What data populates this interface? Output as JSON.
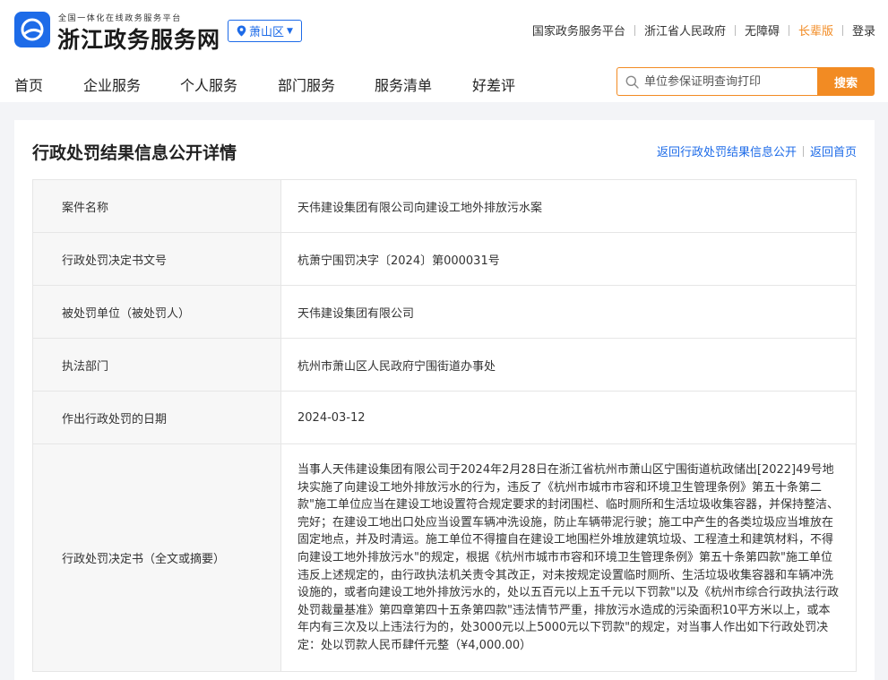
{
  "header": {
    "slogan": "全国一体化在线政务服务平台",
    "site_title": "浙江政务服务网",
    "region": "萧山区",
    "top_links": [
      "国家政务服务平台",
      "浙江省人民政府",
      "无障碍",
      "长辈版",
      "登录"
    ]
  },
  "nav": {
    "items": [
      "首页",
      "企业服务",
      "个人服务",
      "部门服务",
      "服务清单",
      "好差评"
    ]
  },
  "search": {
    "placeholder": "单位参保证明查询打印",
    "button": "搜索"
  },
  "panel": {
    "title": "行政处罚结果信息公开详情",
    "links": [
      "返回行政处罚结果信息公开",
      "返回首页"
    ]
  },
  "details": [
    {
      "label": "案件名称",
      "value": "天伟建设集团有限公司向建设工地外排放污水案"
    },
    {
      "label": "行政处罚决定书文号",
      "value": "杭萧宁围罚决字〔2024〕第000031号"
    },
    {
      "label": "被处罚单位（被处罚人）",
      "value": "天伟建设集团有限公司"
    },
    {
      "label": "执法部门",
      "value": "杭州市萧山区人民政府宁围街道办事处"
    },
    {
      "label": "作出行政处罚的日期",
      "value": "2024-03-12"
    },
    {
      "label": "行政处罚决定书（全文或摘要）",
      "value": "当事人天伟建设集团有限公司于2024年2月28日在浙江省杭州市萧山区宁围街道杭政储出[2022]49号地块实施了向建设工地外排放污水的行为，违反了《杭州市城市市容和环境卫生管理条例》第五十条第二款\"施工单位应当在建设工地设置符合规定要求的封闭围栏、临时厕所和生活垃圾收集容器，并保持整洁、完好；在建设工地出口处应当设置车辆冲洗设施，防止车辆带泥行驶；施工中产生的各类垃圾应当堆放在固定地点，并及时清运。施工单位不得擅自在建设工地围栏外堆放建筑垃圾、工程渣土和建筑材料，不得向建设工地外排放污水\"的规定，根据《杭州市城市市容和环境卫生管理条例》第五十条第四款\"施工单位违反上述规定的，由行政执法机关责令其改正，对未按规定设置临时厕所、生活垃圾收集容器和车辆冲洗设施的，或者向建设工地外排放污水的，处以五百元以上五千元以下罚款\"以及《杭州市综合行政执法行政处罚裁量基准》第四章第四十五条第四款\"违法情节严重，排放污水造成的污染面积10平方米以上，或本年内有三次及以上违法行为的，处3000元以上5000元以下罚款\"的规定，对当事人作出如下行政处罚决定：处以罚款人民币肆仟元整（¥4,000.00）"
    }
  ],
  "colors": {
    "brand_blue": "#1d6be8",
    "accent_orange": "#f28b23"
  }
}
